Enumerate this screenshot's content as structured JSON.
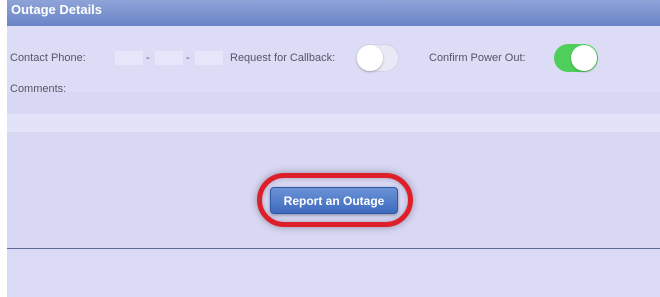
{
  "header": {
    "title": "Outage Details"
  },
  "form": {
    "contact_phone_label": "Contact Phone:",
    "phone_dash1": "-",
    "phone_dash2": "-",
    "callback_label": "Request for Callback:",
    "confirm_label": "Confirm Power Out:",
    "comments_label": "Comments:",
    "callback_toggle": "off",
    "confirm_toggle": "on"
  },
  "actions": {
    "report_label": "Report an Outage"
  },
  "colors": {
    "header": "#7b92d0",
    "toggle_on": "#4fcf5a",
    "button": "#4a74c6",
    "highlight_ring": "#dd1f2a"
  }
}
